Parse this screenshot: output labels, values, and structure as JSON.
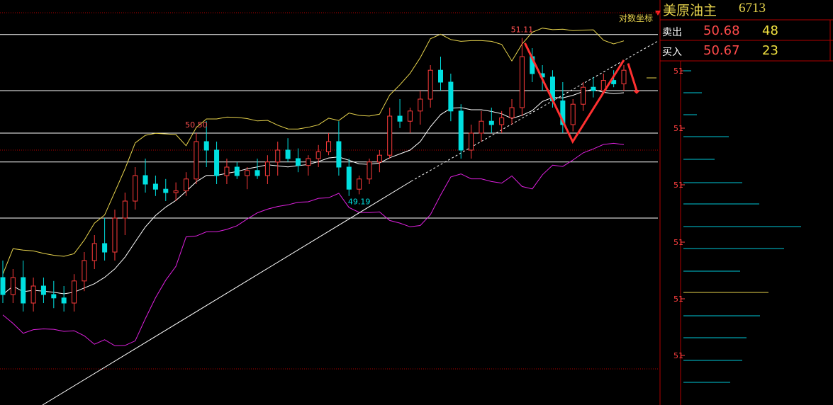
{
  "quote": {
    "name": "美原油主",
    "code": "6713",
    "sell_label": "卖出",
    "sell_price": "50.68",
    "sell_volume": "48",
    "buy_label": "买入",
    "buy_price": "50.67",
    "buy_volume": "23"
  },
  "log_axis_label": "对数坐标",
  "price_axis_ticks": [
    "51",
    "51",
    "51",
    "51",
    "51",
    "51"
  ],
  "colors": {
    "up": "#ff3b3b",
    "down": "#00e0e0",
    "mid_band": "#ffffff",
    "upper_band": "#e8d44d",
    "lower_band": "#e020e0",
    "trendline": "#ffffff",
    "arrow": "#ff3030",
    "grid_white": "#ffffff",
    "grid_red": "#b00000",
    "volume_bar": "#00c8d8",
    "volume_highlight": "#e8d44d"
  },
  "chart_data": {
    "type": "candlestick",
    "title": "",
    "annotations": [
      {
        "text": "50.50",
        "kind": "high"
      },
      {
        "text": "51.11",
        "kind": "high"
      },
      {
        "text": "49.19",
        "kind": "low"
      }
    ],
    "ylim": [
      49.0,
      51.25
    ],
    "horizontal_levels": [
      51.13,
      50.8,
      50.55,
      50.38,
      50.05
    ],
    "ohlc": [
      [
        49.7,
        49.8,
        49.55,
        49.6
      ],
      [
        49.6,
        49.75,
        49.55,
        49.7
      ],
      [
        49.7,
        49.8,
        49.5,
        49.55
      ],
      [
        49.55,
        49.7,
        49.5,
        49.65
      ],
      [
        49.65,
        49.7,
        49.55,
        49.6
      ],
      [
        49.6,
        49.68,
        49.52,
        49.58
      ],
      [
        49.58,
        49.65,
        49.5,
        49.55
      ],
      [
        49.55,
        49.72,
        49.5,
        49.68
      ],
      [
        49.68,
        49.85,
        49.62,
        49.8
      ],
      [
        49.8,
        49.95,
        49.75,
        49.9
      ],
      [
        49.9,
        50.05,
        49.8,
        49.85
      ],
      [
        49.85,
        50.1,
        49.8,
        50.05
      ],
      [
        50.05,
        50.2,
        49.95,
        50.15
      ],
      [
        50.15,
        50.35,
        50.1,
        50.3
      ],
      [
        50.3,
        50.4,
        50.2,
        50.25
      ],
      [
        50.25,
        50.3,
        50.18,
        50.22
      ],
      [
        50.22,
        50.28,
        50.15,
        50.2
      ],
      [
        50.2,
        50.26,
        50.15,
        50.21
      ],
      [
        50.21,
        50.32,
        50.18,
        50.28
      ],
      [
        50.28,
        50.55,
        50.25,
        50.5
      ],
      [
        50.5,
        50.62,
        50.35,
        50.45
      ],
      [
        50.45,
        50.5,
        50.25,
        50.3
      ],
      [
        50.3,
        50.4,
        50.25,
        50.35
      ],
      [
        50.35,
        50.38,
        50.28,
        50.3
      ],
      [
        50.3,
        50.35,
        50.22,
        50.33
      ],
      [
        50.33,
        50.4,
        50.28,
        50.3
      ],
      [
        50.3,
        50.42,
        50.25,
        50.38
      ],
      [
        50.38,
        50.5,
        50.3,
        50.45
      ],
      [
        50.45,
        50.52,
        50.38,
        50.4
      ],
      [
        50.4,
        50.46,
        50.32,
        50.36
      ],
      [
        50.36,
        50.42,
        50.3,
        50.4
      ],
      [
        50.4,
        50.48,
        50.35,
        50.44
      ],
      [
        50.44,
        50.55,
        50.42,
        50.5
      ],
      [
        50.5,
        50.62,
        50.3,
        50.35
      ],
      [
        50.35,
        50.4,
        50.18,
        50.22
      ],
      [
        50.22,
        50.3,
        50.19,
        50.28
      ],
      [
        50.28,
        50.4,
        50.25,
        50.38
      ],
      [
        50.38,
        50.45,
        50.32,
        50.42
      ],
      [
        50.42,
        50.7,
        50.4,
        50.65
      ],
      [
        50.65,
        50.75,
        50.58,
        50.62
      ],
      [
        50.62,
        50.7,
        50.55,
        50.68
      ],
      [
        50.68,
        50.8,
        50.6,
        50.75
      ],
      [
        50.75,
        50.95,
        50.7,
        50.92
      ],
      [
        50.92,
        51.0,
        50.8,
        50.85
      ],
      [
        50.85,
        50.9,
        50.62,
        50.68
      ],
      [
        50.68,
        50.72,
        50.4,
        50.45
      ],
      [
        50.45,
        50.6,
        50.4,
        50.55
      ],
      [
        50.55,
        50.68,
        50.5,
        50.62
      ],
      [
        50.62,
        50.7,
        50.55,
        50.6
      ],
      [
        50.6,
        50.68,
        50.55,
        50.64
      ],
      [
        50.64,
        50.75,
        50.6,
        50.7
      ],
      [
        50.7,
        51.11,
        50.65,
        51.0
      ],
      [
        51.0,
        51.05,
        50.85,
        50.9
      ],
      [
        50.9,
        50.95,
        50.8,
        50.88
      ],
      [
        50.88,
        50.92,
        50.7,
        50.74
      ],
      [
        50.74,
        50.85,
        50.55,
        50.6
      ],
      [
        50.6,
        50.75,
        50.56,
        50.72
      ],
      [
        50.72,
        50.85,
        50.68,
        50.82
      ],
      [
        50.82,
        50.88,
        50.76,
        50.8
      ],
      [
        50.8,
        50.9,
        50.78,
        50.86
      ],
      [
        50.86,
        50.92,
        50.82,
        50.84
      ],
      [
        50.84,
        50.95,
        50.8,
        50.92
      ]
    ]
  }
}
